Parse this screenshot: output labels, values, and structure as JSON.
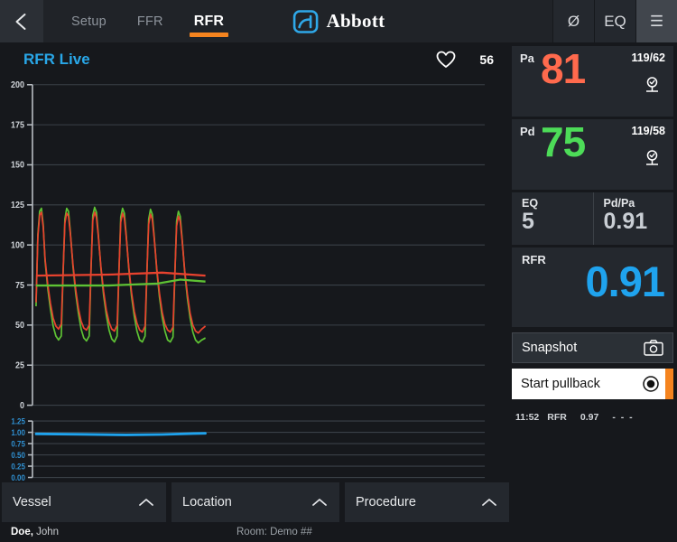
{
  "topbar": {
    "back_icon": "arrow-left-icon",
    "tabs": [
      {
        "label": "Setup",
        "active": false
      },
      {
        "label": "FFR",
        "active": false
      },
      {
        "label": "RFR",
        "active": true
      }
    ],
    "brand": "Abbott",
    "actions": [
      {
        "label": "Ø",
        "name": "zero-button"
      },
      {
        "label": "EQ",
        "name": "equalize-button"
      },
      {
        "label": "☰",
        "name": "menu-button"
      }
    ],
    "accent_color": "#f5841f",
    "brand_blue": "#2fa8e8"
  },
  "chart": {
    "title": "RFR Live",
    "heart_icon": "heart-icon",
    "heart_rate": "56"
  },
  "chart_data": {
    "type": "line",
    "title": "RFR Live",
    "panels": [
      {
        "name": "pressure",
        "ylabel": "",
        "ylim": [
          0,
          200
        ],
        "yticks": [
          "0",
          "25",
          "50",
          "75",
          "100",
          "125",
          "150",
          "175",
          "200"
        ],
        "grid": true,
        "tick_color": "#cfd3d8",
        "series": [
          {
            "name": "Pa",
            "color": "#e8422e",
            "mean": 81,
            "systolic": 119,
            "diastolic": 62
          },
          {
            "name": "Pd",
            "color": "#5ec234",
            "mean": 75,
            "systolic": 119,
            "diastolic": 58
          }
        ],
        "beats": 6,
        "peak": 124,
        "trough": 61
      },
      {
        "name": "ratio",
        "ylim": [
          0.0,
          1.25
        ],
        "yticks": [
          "0.00",
          "0.25",
          "0.50",
          "0.75",
          "1.00",
          "1.25"
        ],
        "grid": true,
        "tick_color": "#2f8fd0",
        "series": [
          {
            "name": "Pd/Pa",
            "color": "#1fa3ee",
            "value": 1.0
          }
        ]
      }
    ]
  },
  "vitals": [
    {
      "label": "Pa",
      "value": "81",
      "pressure": "119/62",
      "color": "#ff6a4d",
      "transducer_icon": "transducer-ok-icon"
    },
    {
      "label": "Pd",
      "value": "75",
      "pressure": "119/58",
      "color": "#4ddc58",
      "transducer_icon": "transducer-ok-icon"
    }
  ],
  "ratios": [
    {
      "label": "EQ",
      "value": "5"
    },
    {
      "label": "Pd/Pa",
      "value": "0.91"
    }
  ],
  "rfr": {
    "label": "RFR",
    "value": "0.91",
    "color": "#1fa3ee"
  },
  "buttons": {
    "snapshot": {
      "label": "Snapshot",
      "icon": "camera-icon"
    },
    "pullback": {
      "label": "Start pullback",
      "icon": "record-icon",
      "accent": "#f5841f"
    }
  },
  "history": [
    {
      "time": "11:52",
      "type": "RFR",
      "value": "0.97",
      "extra": "- - -"
    }
  ],
  "selectors": [
    {
      "label": "Vessel",
      "icon": "chevron-up-icon"
    },
    {
      "label": "Location",
      "icon": "chevron-up-icon"
    },
    {
      "label": "Procedure",
      "icon": "chevron-up-icon"
    }
  ],
  "status": {
    "patient_last": "Doe,",
    "patient_first": "John",
    "room_label": "Room:",
    "room_value": "Demo ##"
  }
}
